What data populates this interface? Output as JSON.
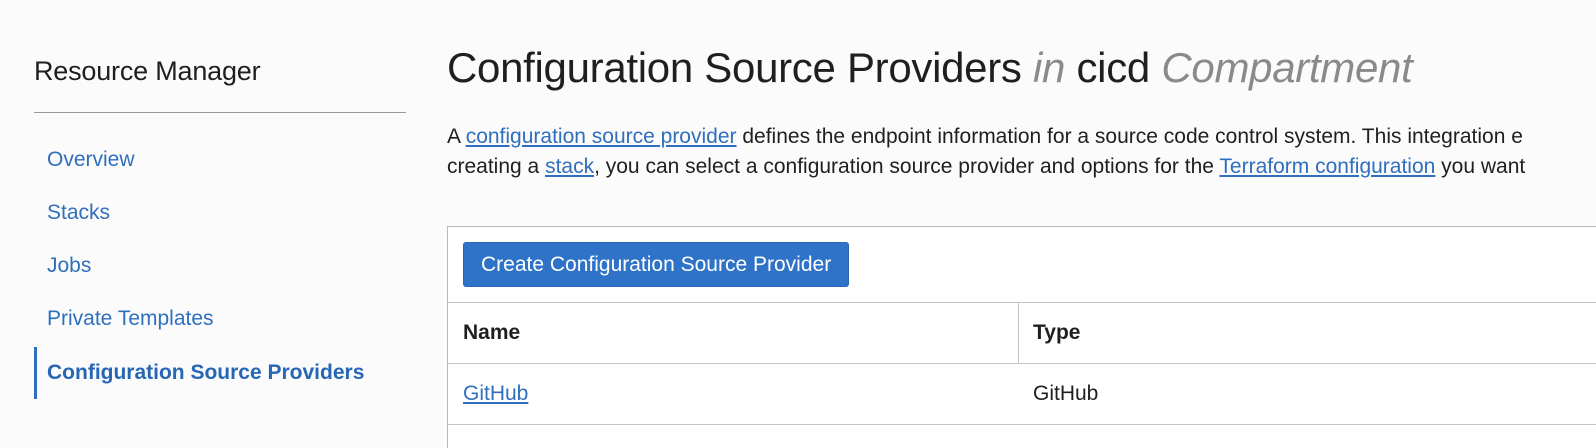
{
  "sidebar": {
    "title": "Resource Manager",
    "items": [
      {
        "label": "Overview",
        "active": false
      },
      {
        "label": "Stacks",
        "active": false
      },
      {
        "label": "Jobs",
        "active": false
      },
      {
        "label": "Private Templates",
        "active": false
      },
      {
        "label": "Configuration Source Providers",
        "active": true
      }
    ]
  },
  "main": {
    "title": {
      "main": "Configuration Source Providers",
      "in": "in",
      "compartment": "cicd",
      "suffix": "Compartment"
    },
    "description": {
      "line1": {
        "t1": "A ",
        "link1": "configuration source provider",
        "t2": " defines the endpoint information for a source code control system. This integration e"
      },
      "line2": {
        "t1": "creating a ",
        "link1": "stack",
        "t2": ", you can select a configuration source provider and options for the ",
        "link2": "Terraform configuration",
        "t3": " you want"
      }
    },
    "create_button": "Create Configuration Source Provider",
    "table": {
      "columns": [
        "Name",
        "Type"
      ],
      "rows": [
        {
          "name": "GitHub",
          "type": "GitHub"
        }
      ]
    }
  },
  "colors": {
    "link": "#2f6fbe",
    "primary_button": "#2f73c9",
    "text": "#1f1f1f",
    "muted_text": "#8a8a8a"
  }
}
